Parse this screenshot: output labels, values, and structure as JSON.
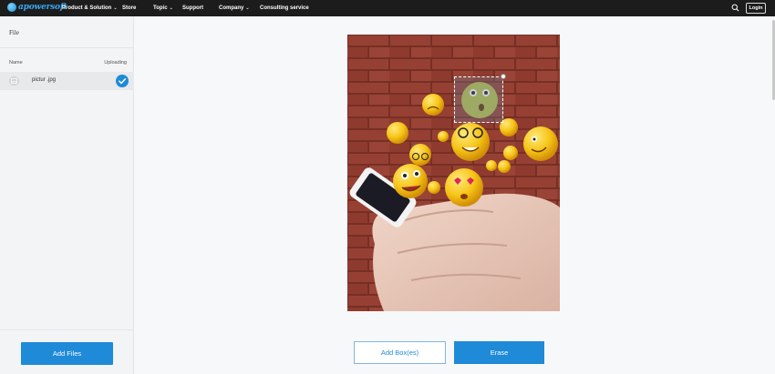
{
  "header": {
    "logo_text": "apowersoft",
    "nav": [
      {
        "label": "Product & Solution",
        "dropdown": true
      },
      {
        "label": "Store",
        "dropdown": false
      },
      {
        "label": "Topic",
        "dropdown": true
      },
      {
        "label": "Support",
        "dropdown": false
      },
      {
        "label": "Company",
        "dropdown": true
      },
      {
        "label": "Consulting service",
        "dropdown": false
      }
    ],
    "search_icon": "search-icon",
    "login_label": "Login"
  },
  "sidebar": {
    "title": "File",
    "col_name": "Name",
    "col_status": "Uploading",
    "files": [
      {
        "name": "pictur   .jpg",
        "status": "done",
        "icon": "image-icon"
      }
    ],
    "add_files_label": "Add Files"
  },
  "editor": {
    "image_description_icon": "photo-canvas",
    "selection_box_count": 1
  },
  "actions": {
    "add_boxes_label": "Add Box(es)",
    "erase_label": "Erase"
  },
  "colors": {
    "topbar": "#1c1c1c",
    "accent": "#1e8ad8",
    "sidebar_bg": "#f3f4f6"
  }
}
